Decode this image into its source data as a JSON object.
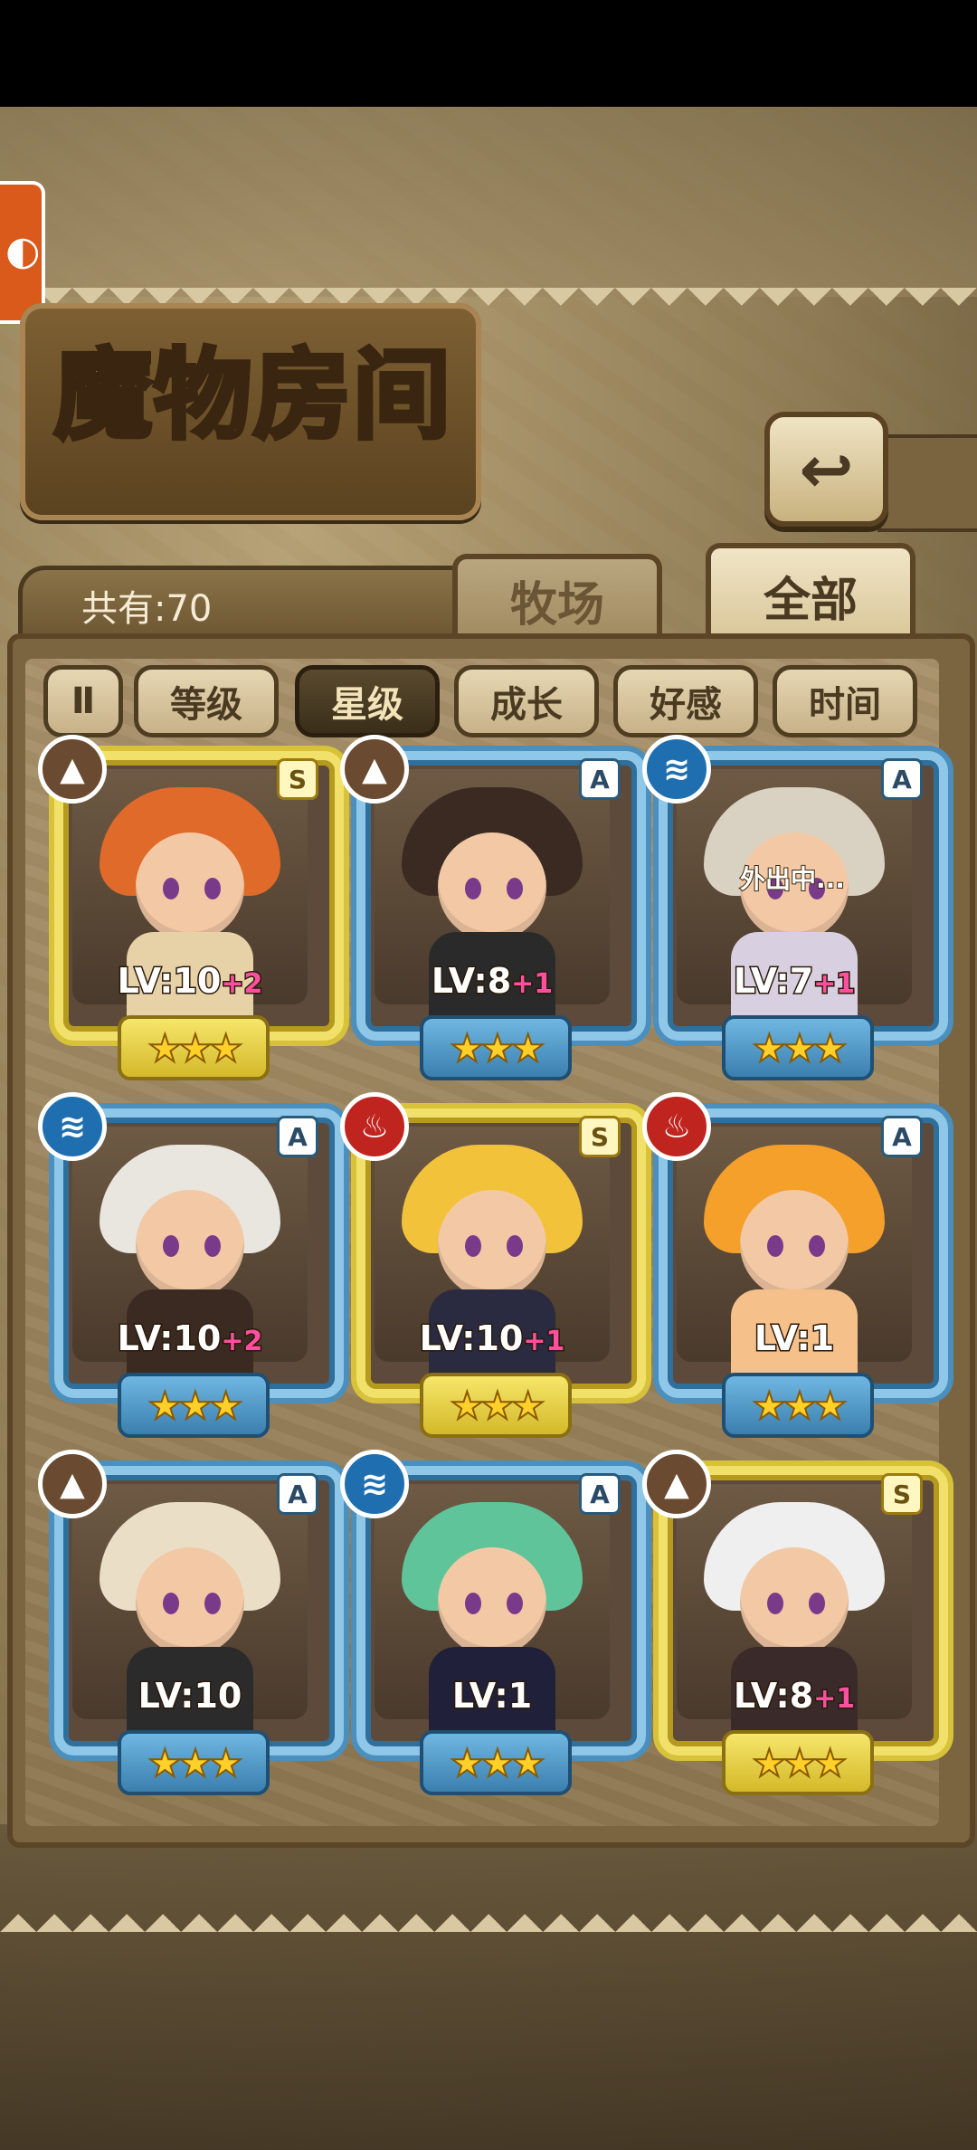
{
  "header": {
    "title": "魔物房间",
    "back_icon": "back-arrow-icon",
    "count_label": "共有:70"
  },
  "tabs": [
    {
      "label": "牧场",
      "active": false
    },
    {
      "label": "全部",
      "active": true
    }
  ],
  "filters": {
    "toggle_label": "Ⅱ",
    "items": [
      {
        "label": "等级",
        "active": false
      },
      {
        "label": "星级",
        "active": true
      },
      {
        "label": "成长",
        "active": false
      },
      {
        "label": "好感",
        "active": false
      },
      {
        "label": "时间",
        "active": false
      }
    ]
  },
  "cards": [
    {
      "rarity": "S",
      "element": "earth",
      "level": "LV:10",
      "bonus": "+2",
      "stars": "★★★",
      "status": ""
    },
    {
      "rarity": "A",
      "element": "earth",
      "level": "LV:8",
      "bonus": "+1",
      "stars": "★★★",
      "status": ""
    },
    {
      "rarity": "A",
      "element": "water",
      "level": "LV:7",
      "bonus": "+1",
      "stars": "★★★",
      "status": "外出中..."
    },
    {
      "rarity": "A",
      "element": "water",
      "level": "LV:10",
      "bonus": "+2",
      "stars": "★★★",
      "status": ""
    },
    {
      "rarity": "S",
      "element": "fire",
      "level": "LV:10",
      "bonus": "+1",
      "stars": "★★★",
      "status": ""
    },
    {
      "rarity": "A",
      "element": "fire",
      "level": "LV:1",
      "bonus": "",
      "stars": "★★★",
      "status": ""
    },
    {
      "rarity": "A",
      "element": "earth",
      "level": "LV:10",
      "bonus": "",
      "stars": "★★★",
      "status": ""
    },
    {
      "rarity": "A",
      "element": "water",
      "level": "LV:1",
      "bonus": "",
      "stars": "★★★",
      "status": ""
    },
    {
      "rarity": "S",
      "element": "earth",
      "level": "LV:8",
      "bonus": "+1",
      "stars": "★★★",
      "status": ""
    }
  ],
  "element_icons": {
    "earth": "mountain-icon",
    "water": "water-waves-icon",
    "fire": "flame-icon"
  },
  "colors": {
    "earth": "#6a4a30",
    "water": "#1f6fb0",
    "fire": "#c0241e",
    "rarity_S": "#f1e16a",
    "rarity_A": "#8fc7e8"
  }
}
